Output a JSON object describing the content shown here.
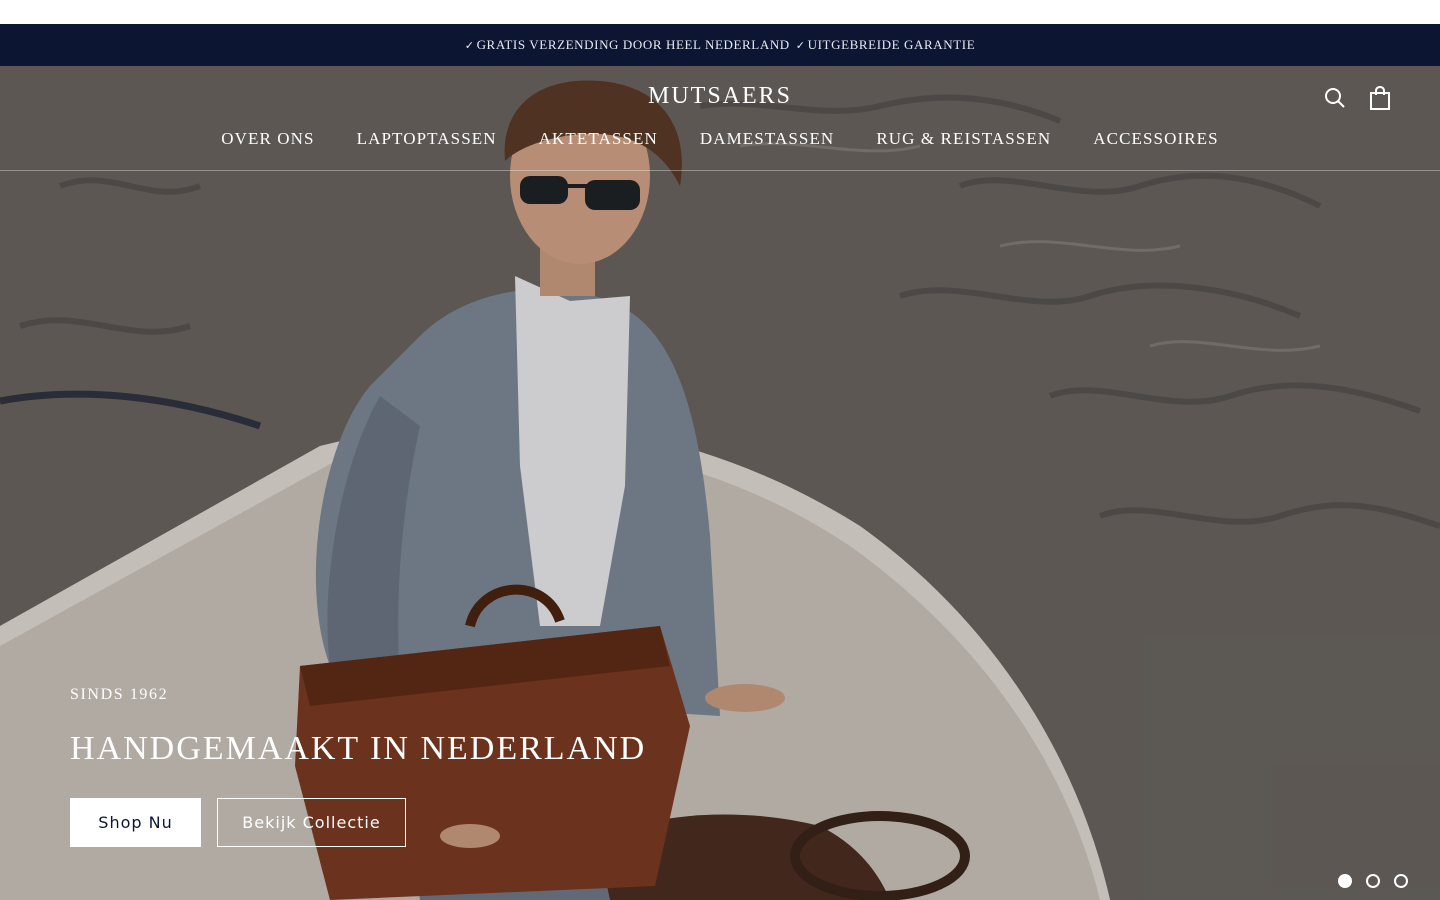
{
  "announcement": {
    "items": [
      "GRATIS VERZENDING DOOR HEEL NEDERLAND",
      "UITGEBREIDE GARANTIE"
    ],
    "check_glyph": "✓"
  },
  "header": {
    "logo": "MUTSAERS",
    "icons": [
      "search-icon",
      "cart-icon"
    ],
    "nav": [
      "OVER ONS",
      "LAPTOPTASSEN",
      "AKTETASSEN",
      "DAMESTASSEN",
      "RUG & REISTASSEN",
      "ACCESSOIRES"
    ]
  },
  "hero": {
    "eyebrow": "SINDS 1962",
    "headline": "HANDGEMAAKT IN NEDERLAND",
    "primary_cta": "Shop Nu",
    "secondary_cta": "Bekijk Collectie",
    "slides_total": 3,
    "active_slide": 1
  },
  "colors": {
    "announcement_bg": "#0c1633",
    "text_on_hero": "#ffffff",
    "primary_button_text": "#0c1633"
  }
}
